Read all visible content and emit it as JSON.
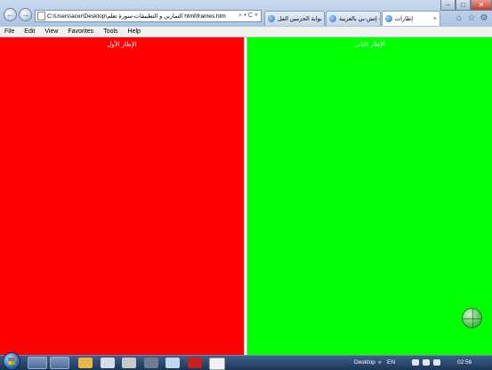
{
  "browser": {
    "address_url": "C:\\Users\\acer\\Desktop\\التمارين و التطبيقات-سورة تعلم html\\frames.htm",
    "address_actions": "⌕ ▾ C ×",
    "back_glyph": "←",
    "forward_glyph": "→",
    "tabs": [
      {
        "label": "بوابة الحرمين الفل ...",
        "active": false
      },
      {
        "label": "إتش-بي بالعربية - ...",
        "active": false
      },
      {
        "label": "إطارات",
        "active": true
      }
    ],
    "tab_close": "×",
    "window_buttons": [
      "–",
      "□",
      "✕"
    ]
  },
  "menu": {
    "items": [
      "File",
      "Edit",
      "View",
      "Favorites",
      "Tools",
      "Help"
    ]
  },
  "frames": {
    "first_title": "الإطار الأول",
    "second_title": "الإطار الثاني",
    "first_color": "#ff0000",
    "second_color": "#00ff00"
  },
  "taskbar": {
    "desktop_label": "Desktop",
    "chevron": "»",
    "language": "EN",
    "clock": "02:56"
  },
  "icons": [
    "home-icon",
    "favorites-star-icon",
    "settings-gear-icon",
    "globe-icon",
    "windows-start-icon"
  ]
}
